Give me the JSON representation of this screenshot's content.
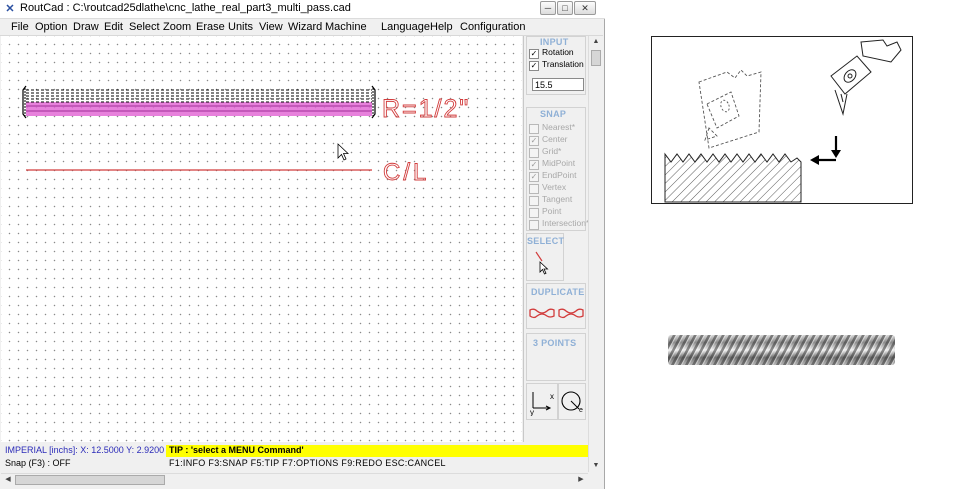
{
  "window": {
    "title": "RoutCad : C:\\routcad25dlathe\\cnc_lathe_real_part3_multi_pass.cad",
    "app_icon": "routcad-icon",
    "controls": [
      "minimize-icon",
      "maximize-icon",
      "close-icon"
    ]
  },
  "menu": [
    "File",
    "Option",
    "Draw",
    "Edit",
    "Select",
    "Zoom",
    "Erase",
    "Units",
    "View",
    "Wizard",
    "Machine",
    "Language",
    "Help",
    "Configuration"
  ],
  "canvas": {
    "label_radius": "R=1/2\"",
    "label_centerline": "C/L",
    "colors": {
      "part_fill": "#e36bd6",
      "label": "#d23c3c",
      "centerline": "#d23c3c",
      "dashes": "#000000"
    }
  },
  "panel": {
    "input": {
      "title": "INPUT",
      "options": [
        {
          "label": "Rotation",
          "checked": true
        },
        {
          "label": "Translation",
          "checked": true
        }
      ],
      "value": "15.5"
    },
    "snap": {
      "title": "SNAP",
      "options": [
        {
          "label": "Nearest*",
          "checked": false
        },
        {
          "label": "Center",
          "checked": true
        },
        {
          "label": "Grid*",
          "checked": false
        },
        {
          "label": "MidPoint",
          "checked": true
        },
        {
          "label": "EndPoint",
          "checked": true
        },
        {
          "label": "Vertex",
          "checked": false
        },
        {
          "label": "Tangent",
          "checked": false
        },
        {
          "label": "Point",
          "checked": false
        },
        {
          "label": "Intersection*",
          "checked": false
        }
      ]
    },
    "select_title": "SELECT",
    "duplicate_title": "DUPLICATE",
    "three_points_title": "3 POINTS",
    "axis_x": "x",
    "axis_y": "y"
  },
  "status": {
    "coords": "IMPERIAL [inchs]: X: 12.5000  Y: 2.9200",
    "snap": "Snap (F3) : OFF",
    "tip": "TIP : 'select a MENU Command'",
    "keys": "F1:INFO  F3:SNAP  F5:TIP  F7:OPTIONS  F9:REDO  ESC:CANCEL"
  }
}
